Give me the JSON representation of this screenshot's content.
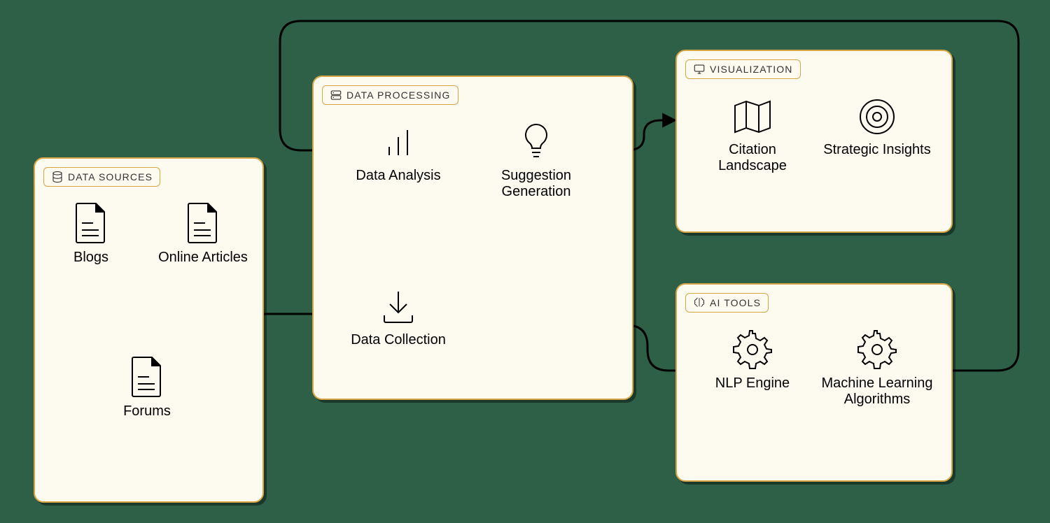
{
  "boxes": {
    "dataSources": {
      "title": "DATA SOURCES",
      "nodes": {
        "blogs": "Blogs",
        "articles": "Online Articles",
        "forums": "Forums"
      }
    },
    "dataProcessing": {
      "title": "DATA PROCESSING",
      "nodes": {
        "analysis": "Data Analysis",
        "suggestion": "Suggestion Generation",
        "collection": "Data Collection"
      }
    },
    "visualization": {
      "title": "VISUALIZATION",
      "nodes": {
        "citation": "Citation Landscape",
        "insights": "Strategic Insights"
      }
    },
    "aiTools": {
      "title": "AI TOOLS",
      "nodes": {
        "nlp": "NLP Engine",
        "ml": "Machine Learning Algorithms"
      }
    }
  }
}
